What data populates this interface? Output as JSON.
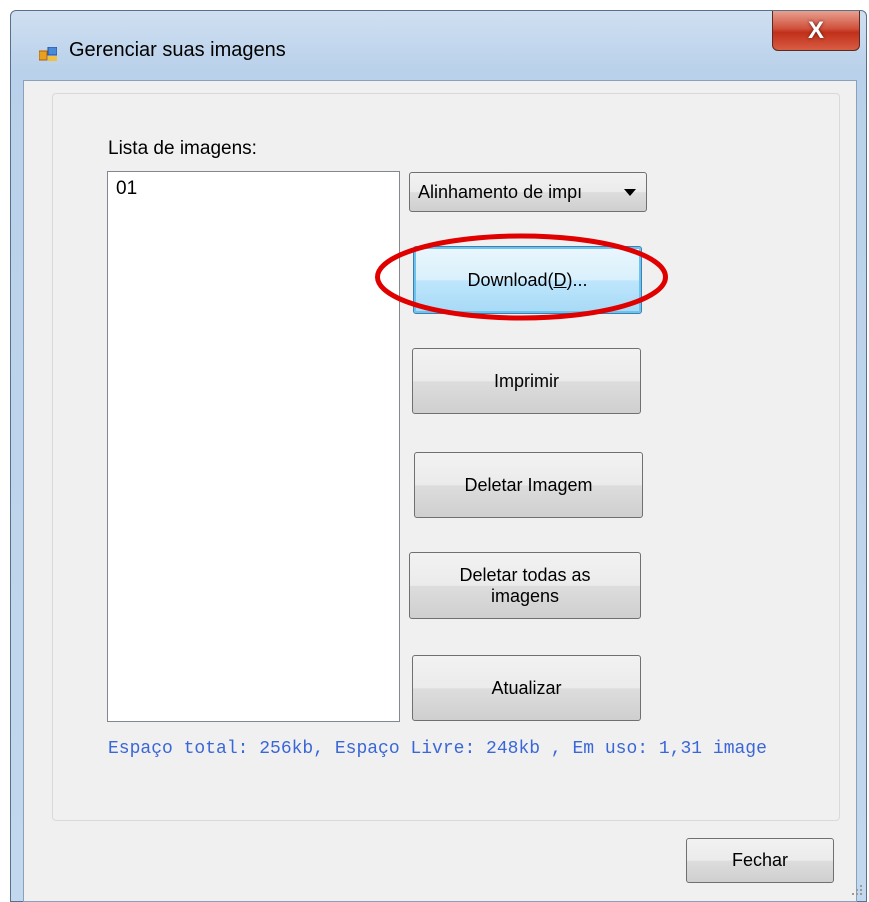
{
  "window": {
    "title": "Gerenciar suas imagens",
    "close_label": "X"
  },
  "list": {
    "label": "Lista de imagens:",
    "items": [
      "01"
    ]
  },
  "combo": {
    "selected": "Alinhamento de impı"
  },
  "buttons": {
    "download": "Download(D)...",
    "imprimir": "Imprimir",
    "deletar_imagem": "Deletar Imagem",
    "deletar_todas": "Deletar todas as imagens",
    "atualizar": "Atualizar",
    "fechar": "Fechar"
  },
  "status": {
    "text": "Espaço total: 256kb, Espaço Livre: 248kb , Em uso: 1,31 image"
  },
  "colors": {
    "highlight": "#e00000",
    "status_text": "#3a67d8",
    "close_button": "#c12f1a"
  },
  "icons": {
    "app": "app-window-icon",
    "close": "close-icon",
    "dropdown": "chevron-down-icon",
    "grip": "resize-grip-icon"
  }
}
